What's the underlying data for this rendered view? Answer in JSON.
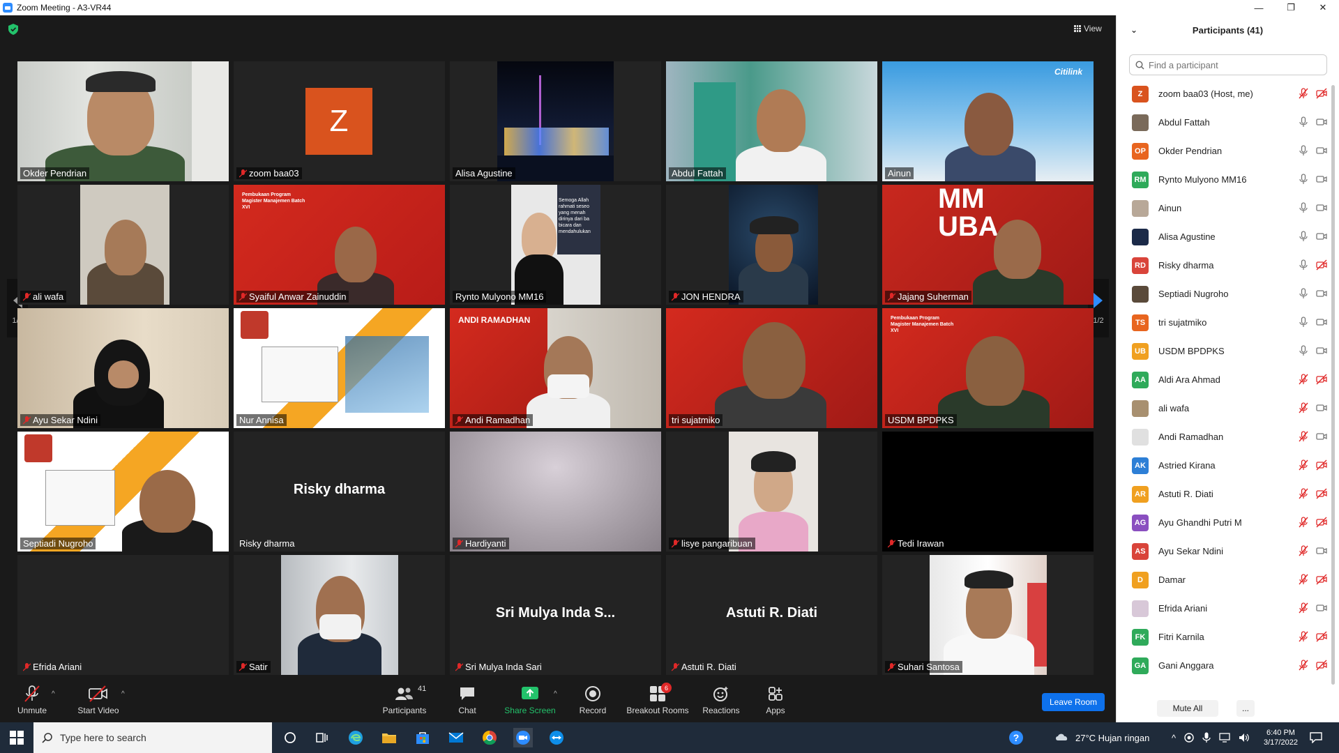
{
  "window": {
    "title": "Zoom Meeting - A3-VR44",
    "minimize": "—",
    "maximize": "❐",
    "close": "✕"
  },
  "view_label": "View",
  "page_indicator": "1/2",
  "tiles": [
    {
      "name": "Okder Pendrian",
      "muted": false,
      "active": true
    },
    {
      "name": "zoom baa03",
      "muted": true,
      "avatar_letter": "Z"
    },
    {
      "name": "Alisa Agustine",
      "muted": false
    },
    {
      "name": "Abdul Fattah",
      "muted": false
    },
    {
      "name": "Ainun",
      "muted": false,
      "brand": "Citilink"
    },
    {
      "name": "ali wafa",
      "muted": true
    },
    {
      "name": "Syaiful Anwar Zainuddin",
      "muted": true
    },
    {
      "name": "Rynto Mulyono MM16",
      "muted": false
    },
    {
      "name": "JON HENDRA",
      "muted": true
    },
    {
      "name": "Jajang Suherman",
      "muted": true,
      "overlay": "MM UBA"
    },
    {
      "name": "Ayu Sekar Ndini",
      "muted": true
    },
    {
      "name": "Nur Annisa",
      "muted": false
    },
    {
      "name": "Andi Ramadhan",
      "muted": true,
      "overlay": "ANDI RAMADHAN"
    },
    {
      "name": "tri sujatmiko",
      "muted": false
    },
    {
      "name": "USDM BPDPKS",
      "muted": false
    },
    {
      "name": "Septiadi Nugroho",
      "muted": false
    },
    {
      "name": "Risky dharma",
      "muted": false,
      "big": "Risky dharma"
    },
    {
      "name": "Hardiyanti",
      "muted": true
    },
    {
      "name": "lisye pangaribuan",
      "muted": true
    },
    {
      "name": "Tedi Irawan",
      "muted": true
    },
    {
      "name": "Efrida Ariani",
      "muted": true
    },
    {
      "name": "Satir",
      "muted": true
    },
    {
      "name": "Sri Mulya Inda Sari",
      "muted": true,
      "big": "Sri Mulya Inda S..."
    },
    {
      "name": "Astuti R. Diati",
      "muted": true,
      "big": "Astuti R. Diati"
    },
    {
      "name": "Suhari Santosa",
      "muted": true
    }
  ],
  "slide_text": {
    "program": "Pembukaan Program Magister Manajemen Batch XVI",
    "quote": "Semoga Allah rahmati seseo yang menah dirinya dari ba bicara dan mendahulukan"
  },
  "toolbar": {
    "unmute": "Unmute",
    "start_video": "Start Video",
    "participants": "Participants",
    "participants_count": "41",
    "chat": "Chat",
    "share_screen": "Share Screen",
    "record": "Record",
    "breakout_rooms": "Breakout Rooms",
    "breakout_badge": "6",
    "reactions": "Reactions",
    "apps": "Apps",
    "leave": "Leave Room"
  },
  "panel": {
    "title": "Participants (41)",
    "search_placeholder": "Find a participant",
    "mute_all": "Mute All",
    "more": "...",
    "participants": [
      {
        "name": "zoom baa03 (Host, me)",
        "initials": "Z",
        "color": "#d9531e",
        "mic": "muted",
        "cam": "off"
      },
      {
        "name": "Abdul Fattah",
        "initials": "",
        "color": "#7a6a5a",
        "mic": "on",
        "cam": "on"
      },
      {
        "name": "Okder Pendrian",
        "initials": "OP",
        "color": "#e8651f",
        "mic": "on",
        "cam": "on"
      },
      {
        "name": "Rynto Mulyono MM16",
        "initials": "RM",
        "color": "#2faa5a",
        "mic": "on",
        "cam": "on"
      },
      {
        "name": "Ainun",
        "initials": "",
        "color": "#b8a898",
        "mic": "on",
        "cam": "on"
      },
      {
        "name": "Alisa Agustine",
        "initials": "",
        "color": "#1b2a48",
        "mic": "on",
        "cam": "on"
      },
      {
        "name": "Risky dharma",
        "initials": "RD",
        "color": "#d9443a",
        "mic": "on",
        "cam": "off"
      },
      {
        "name": "Septiadi Nugroho",
        "initials": "",
        "color": "#5a4a3a",
        "mic": "on",
        "cam": "on"
      },
      {
        "name": "tri sujatmiko",
        "initials": "TS",
        "color": "#e8651f",
        "mic": "on",
        "cam": "on"
      },
      {
        "name": "USDM BPDPKS",
        "initials": "UB",
        "color": "#f0a020",
        "mic": "on",
        "cam": "on"
      },
      {
        "name": "Aldi Ara Ahmad",
        "initials": "AA",
        "color": "#2faa5a",
        "mic": "muted",
        "cam": "off"
      },
      {
        "name": "ali wafa",
        "initials": "",
        "color": "#a89070",
        "mic": "muted",
        "cam": "on"
      },
      {
        "name": "Andi Ramadhan",
        "initials": "",
        "color": "#e0e0e0",
        "mic": "muted",
        "cam": "on"
      },
      {
        "name": "Astried Kirana",
        "initials": "AK",
        "color": "#2d7fd6",
        "mic": "muted",
        "cam": "off"
      },
      {
        "name": "Astuti R. Diati",
        "initials": "AR",
        "color": "#f0a020",
        "mic": "muted",
        "cam": "off"
      },
      {
        "name": "Ayu Ghandhi Putri M",
        "initials": "AG",
        "color": "#8a4fc0",
        "mic": "muted",
        "cam": "off"
      },
      {
        "name": "Ayu Sekar Ndini",
        "initials": "AS",
        "color": "#d9443a",
        "mic": "muted",
        "cam": "on"
      },
      {
        "name": "Damar",
        "initials": "D",
        "color": "#f0a020",
        "mic": "muted",
        "cam": "off"
      },
      {
        "name": "Efrida Ariani",
        "initials": "",
        "color": "#d8c8d8",
        "mic": "muted",
        "cam": "on"
      },
      {
        "name": "Fitri Karnila",
        "initials": "FK",
        "color": "#2faa5a",
        "mic": "muted",
        "cam": "off"
      },
      {
        "name": "Gani Anggara",
        "initials": "GA",
        "color": "#2faa5a",
        "mic": "muted",
        "cam": "off"
      }
    ]
  },
  "taskbar": {
    "search_placeholder": "Type here to search",
    "weather": "27°C  Hujan ringan",
    "time": "6:40 PM",
    "date": "3/17/2022"
  }
}
